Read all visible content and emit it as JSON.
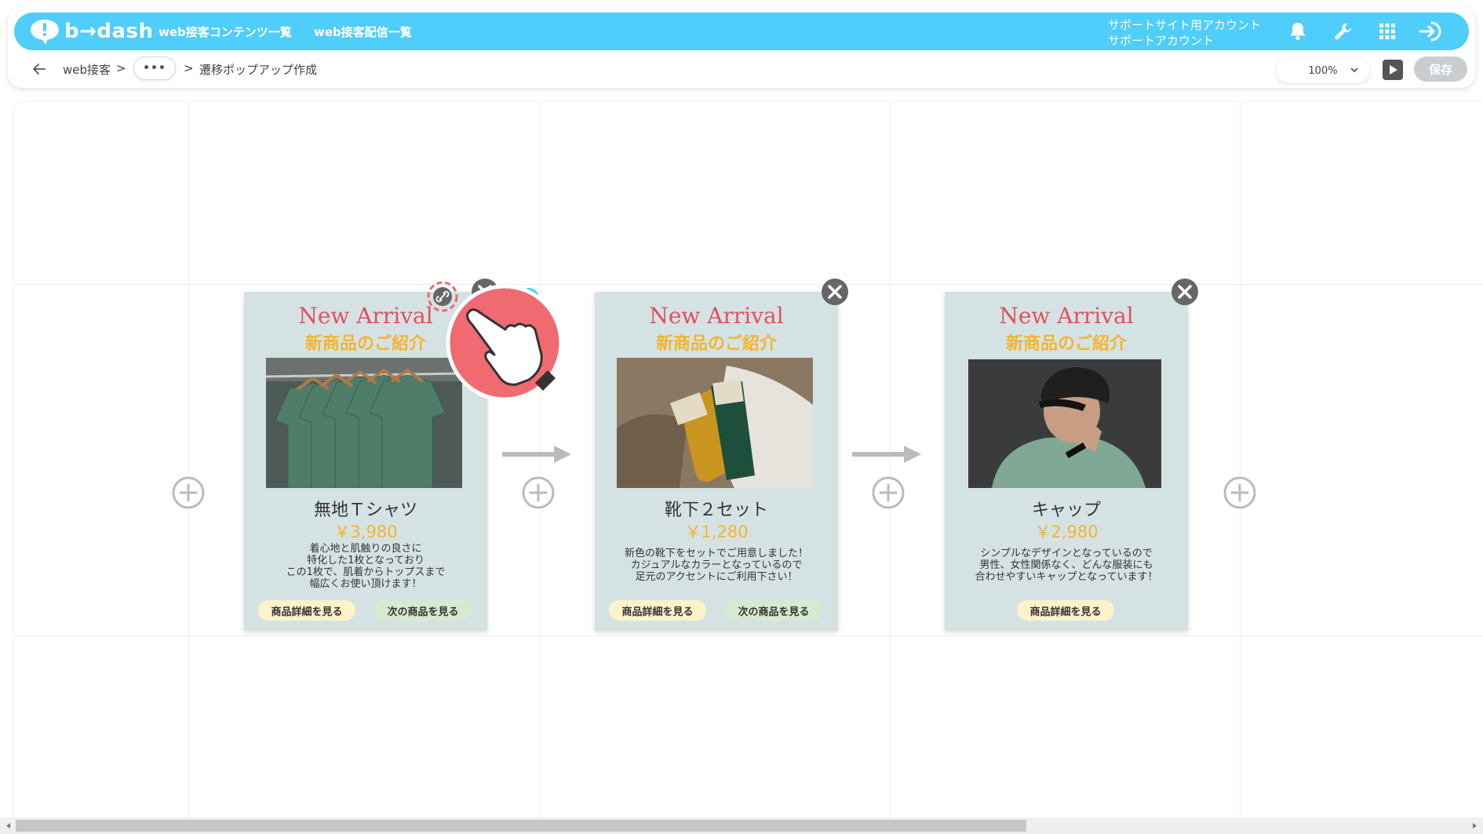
{
  "header": {
    "logo_text": "b→dash",
    "nav": [
      "web接客コンテンツ一覧",
      "web接客配信一覧"
    ],
    "account_line1": "サポートサイト用アカウント",
    "account_line2": "サポートアカウント"
  },
  "breadcrumb": {
    "item1": "web接客",
    "sep1": ">",
    "ellipsis": "•••",
    "sep2": ">",
    "current": "遷移ポップアップ作成"
  },
  "toolbar": {
    "zoom": "100%",
    "save_label": "保存"
  },
  "cards": [
    {
      "title": "New Arrival",
      "subtitle": "新商品のご紹介",
      "name": "無地Ｔシャツ",
      "price": "￥3,980",
      "desc": [
        "着心地と肌触りの良さに",
        "特化した1枚となっており",
        "この1枚で、肌着からトップスまで",
        "幅広くお使い頂けます！"
      ],
      "button_detail": "商品詳細を見る",
      "button_next": "次の商品を見る"
    },
    {
      "title": "New Arrival",
      "subtitle": "新商品のご紹介",
      "name": "靴下２セット",
      "price": "￥1,280",
      "desc": [
        "新色の靴下をセットでご用意しました！",
        "カジュアルなカラーとなっているので",
        "足元のアクセントにご利用下さい！"
      ],
      "button_detail": "商品詳細を見る",
      "button_next": "次の商品を見る"
    },
    {
      "title": "New Arrival",
      "subtitle": "新商品のご紹介",
      "name": "キャップ",
      "price": "￥2,980",
      "desc": [
        "シンプルなデザインとなっているので",
        "男性、女性関係なく、どんな服装にも",
        "合わせやすいキャップとなっています！"
      ],
      "button_detail": "商品詳細を見る"
    }
  ],
  "colors": {
    "brand": "#4fcdfb",
    "card_bg": "#d5e2e4",
    "title": "#e2505f",
    "accent": "#f2b52e",
    "pointer_badge": "#f06a72"
  }
}
